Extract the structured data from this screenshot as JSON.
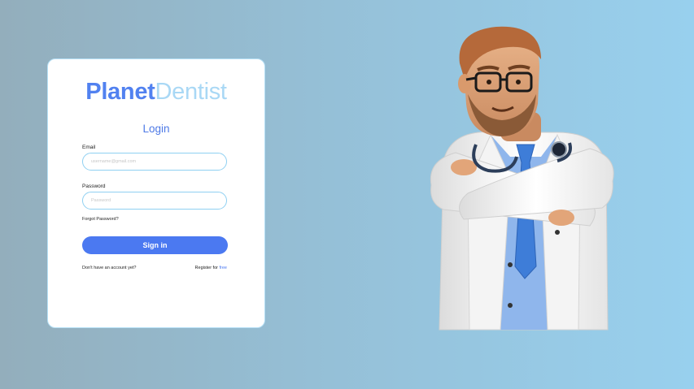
{
  "brand": {
    "part1": "Planet",
    "part2": "Dentist"
  },
  "login": {
    "title": "Login",
    "email_label": "Email",
    "email_placeholder": "username@gmail.com",
    "password_label": "Password",
    "password_placeholder": "Password",
    "forgot_label": "Forgot Password?",
    "signin_label": "Sign in",
    "no_account_text": "Don't have an account yet?",
    "register_text": "Register for ",
    "register_link": "free"
  },
  "illustration": {
    "icon": "doctor-illustration"
  },
  "colors": {
    "accent": "#4b79f1",
    "brand_light": "#a9d8f5",
    "input_border": "#8fd0f2"
  }
}
